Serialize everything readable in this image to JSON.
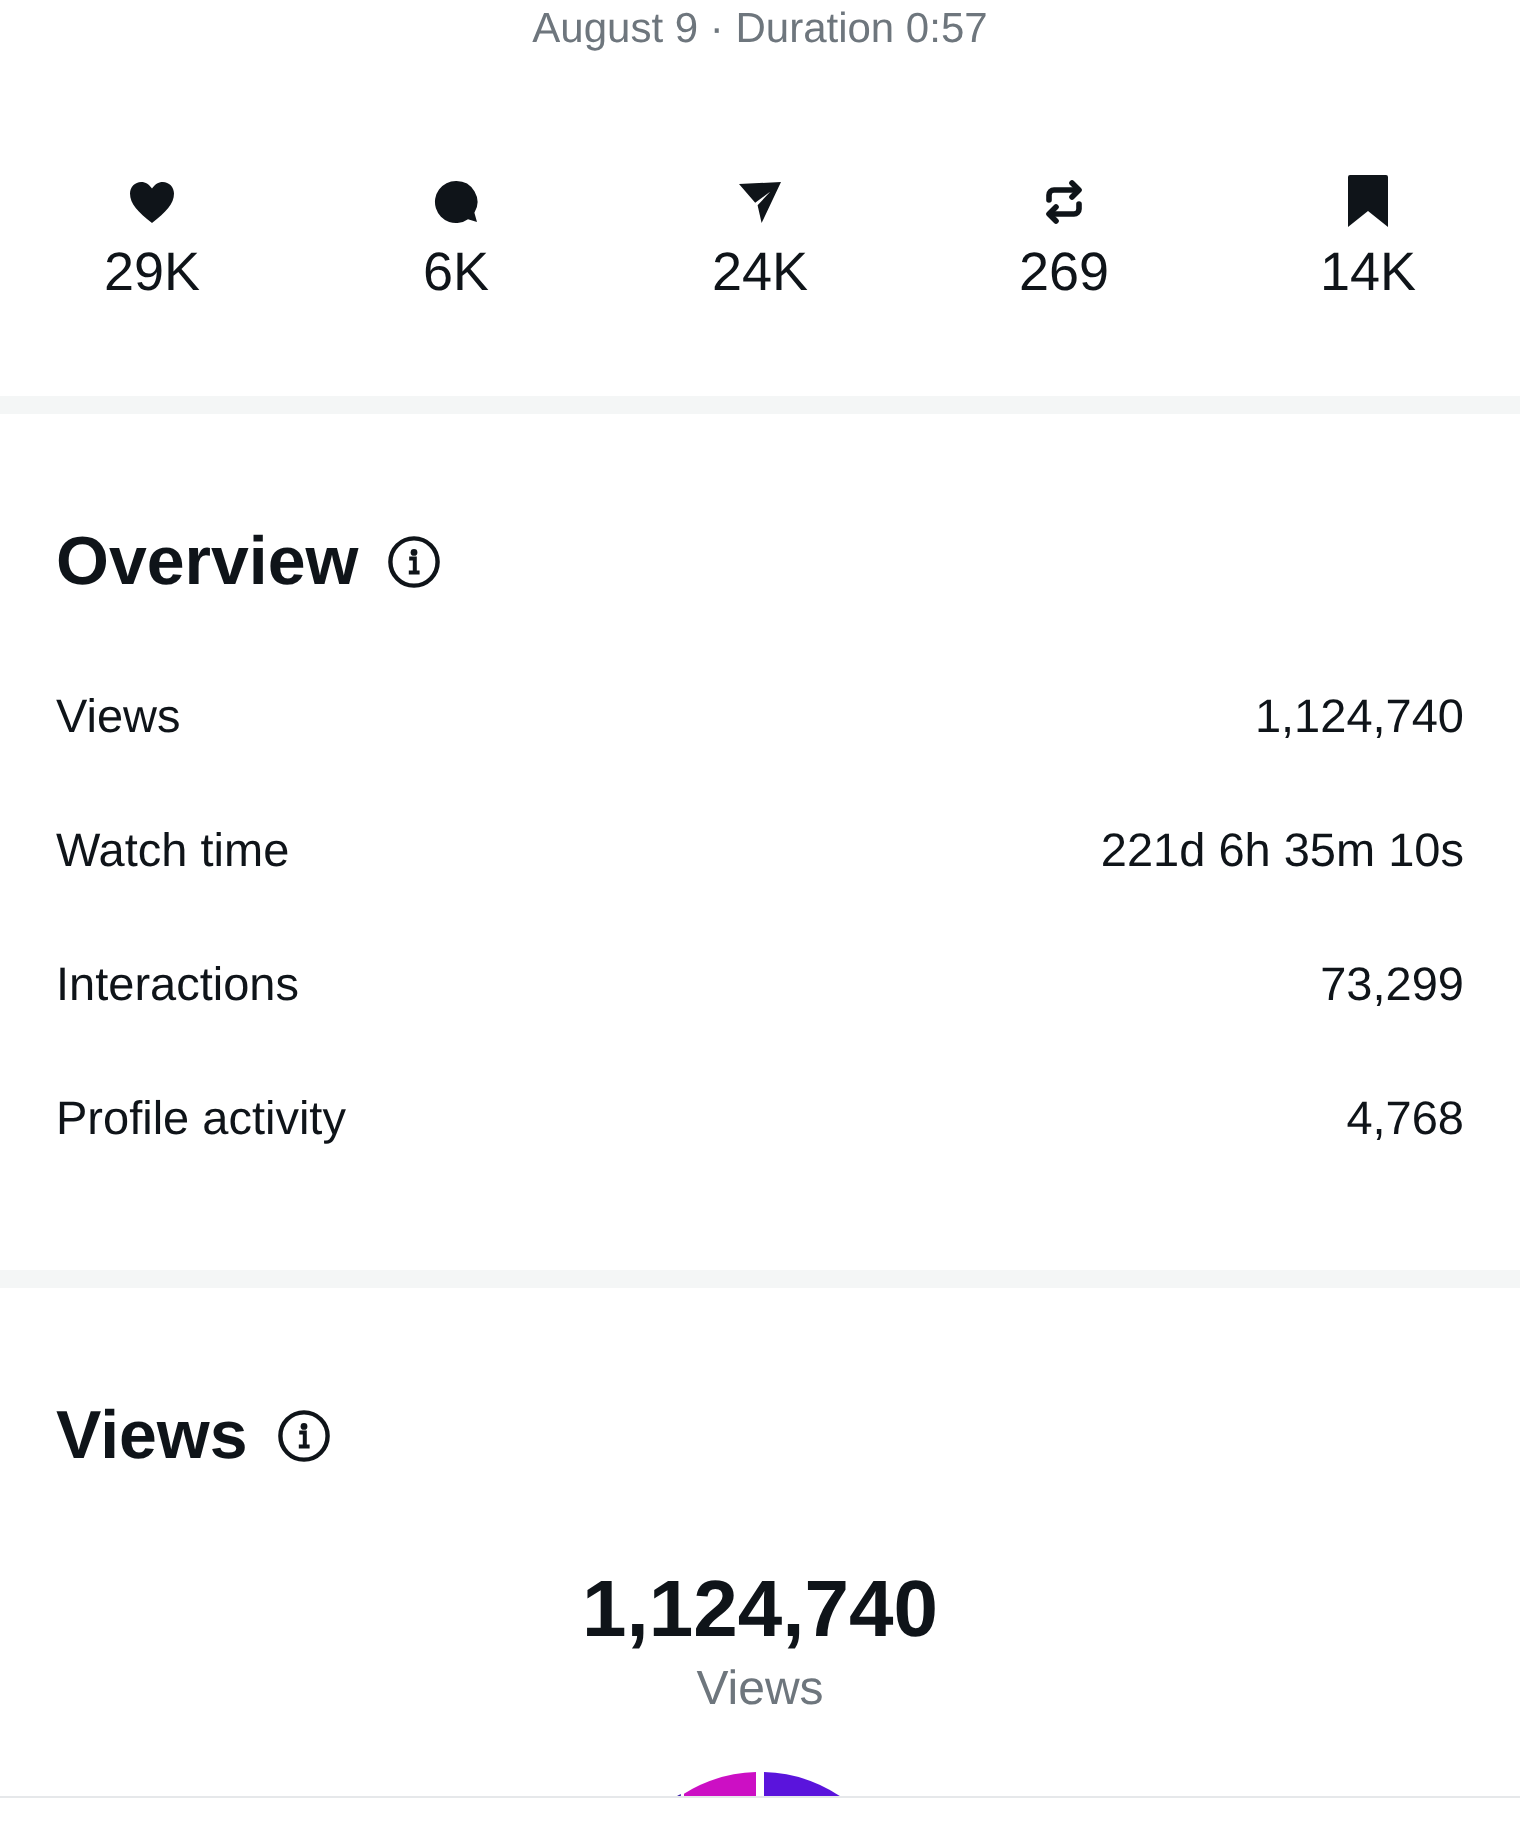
{
  "header": {
    "subtitle": "August 9 · Duration 0:57"
  },
  "stats": [
    {
      "kind": "heart",
      "value": "29K"
    },
    {
      "kind": "comment",
      "value": "6K"
    },
    {
      "kind": "send",
      "value": "24K"
    },
    {
      "kind": "repost",
      "value": "269"
    },
    {
      "kind": "bookmark",
      "value": "14K"
    }
  ],
  "overview": {
    "title": "Overview",
    "rows": [
      {
        "label": "Views",
        "value": "1,124,740"
      },
      {
        "label": "Watch time",
        "value": "221d 6h 35m 10s"
      },
      {
        "label": "Interactions",
        "value": "73,299"
      },
      {
        "label": "Profile activity",
        "value": "4,768"
      }
    ]
  },
  "views": {
    "title": "Views",
    "total": "1,124,740",
    "total_label": "Views"
  }
}
